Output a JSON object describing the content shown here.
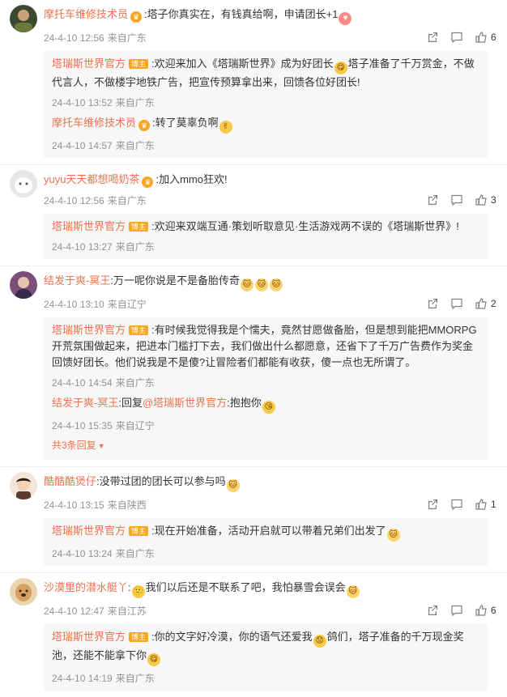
{
  "threads": [
    {
      "user": "摩托车维修技术员",
      "user_badge": "👑",
      "text": ":塔子你真实在，有钱真给啊，申请团长+1",
      "text_emoji": "😍",
      "time": "24-4-10 12:56",
      "location": "来自广东",
      "likes": "6",
      "avatar_color": "#3b4a2e",
      "replies": [
        {
          "user": "塔瑞斯世界官方",
          "official_mark": "博主",
          "text_a": ":欢迎来加入《塔瑞斯世界》成为好团长",
          "text_emoji": "😋",
          "text_b": "塔子准备了千万赏金，不做代言人，不做楼宇地铁广告，把宣传预算拿出来，回馈各位好团长!",
          "time": "24-4-10 13:52",
          "location": "来自广东"
        },
        {
          "user": "摩托车维修技术员",
          "user_badge": "👑",
          "text_a": ":转了莫辜负啊",
          "text_emoji": "✌",
          "time": "24-4-10 14:57",
          "location": "来自广东"
        }
      ]
    },
    {
      "user": "yuyu天天都想喝奶茶",
      "user_badge": "👑",
      "text": ":加入mmo狂欢!",
      "time": "24-4-10 12:56",
      "location": "来自广东",
      "likes": "3",
      "avatar_color": "#d9d9d9",
      "replies": [
        {
          "user": "塔瑞斯世界官方",
          "official_mark": "博主",
          "text_a": ":欢迎来双端互通·策划听取意见·生活游戏两不误的《塔瑞斯世界》!",
          "time": "24-4-10 13:27",
          "location": "来自广东"
        }
      ]
    },
    {
      "user": "结发于爽-冥王",
      "text": ":万一呢你说是不是备胎传奇",
      "time": "24-4-10 13:10",
      "location": "来自辽宁",
      "likes": "2",
      "avatar_color": "#7a4f7a",
      "replies": [
        {
          "user": "塔瑞斯世界官方",
          "official_mark": "博主",
          "text_a": ":有时候我觉得我是个懦夫，竟然甘愿做备胎，但是想到能把MMORPG开荒氛围做起来，把进本门槛打下去，我们做出什么都愿意，还省下了千万广告费作为奖金回馈好团长。他们说我是不是傻?让冒险者们都能有收获，傻一点也无所谓了。",
          "time": "24-4-10 14:54",
          "location": "来自广东"
        },
        {
          "user": "结发于爽-冥王",
          "text_a": ":回复",
          "mention": "@塔瑞斯世界官方",
          "text_b": ":抱抱你",
          "time": "24-4-10 15:35",
          "location": "来自辽宁"
        }
      ],
      "more_label": "共3条回复"
    },
    {
      "user": "酷酷酷煲仔",
      "text": ":没带过团的团长可以参与吗",
      "time": "24-4-10 13:15",
      "location": "来自陕西",
      "likes": "1",
      "avatar_color": "#5a3b2e",
      "replies": [
        {
          "user": "塔瑞斯世界官方",
          "official_mark": "博主",
          "text_a": ":现在开始准备，活动开启就可以带着兄弟们出发了",
          "time": "24-4-10 13:24",
          "location": "来自广东"
        }
      ]
    },
    {
      "user": "沙漠里的潜水艇丫",
      "text_a": ":",
      "text": "我们以后还是不联系了吧，我怕暴雪会误会",
      "time": "24-4-10 12:47",
      "location": "来自江苏",
      "likes": "6",
      "avatar_color": "#d8a060",
      "replies": [
        {
          "user": "塔瑞斯世界官方",
          "official_mark": "博主",
          "text_a": ":你的文字好冷漠，你的语气还爱我",
          "text_b": "鸽们，塔子准备的千万现金奖池，还能不能拿下你",
          "time": "24-4-10 14:19",
          "location": "来自广东"
        }
      ]
    }
  ]
}
